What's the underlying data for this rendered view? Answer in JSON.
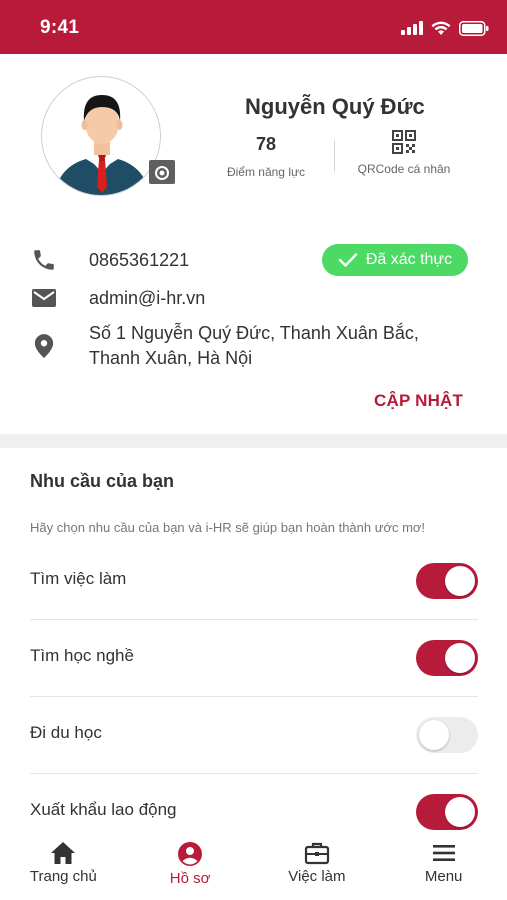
{
  "status_bar": {
    "time": "9:41"
  },
  "profile": {
    "name": "Nguyễn Quý Đức",
    "score_value": "78",
    "score_label": "Điểm năng lực",
    "qr_label": "QRCode cá nhân"
  },
  "contact": {
    "phone": "0865361221",
    "verified_label": "Đã xác thực",
    "email": "admin@i-hr.vn",
    "address_line1": "Số 1 Nguyễn Quý Đức, Thanh Xuân Bắc,",
    "address_line2": "Thanh Xuân, Hà Nội",
    "update_label": "CẬP NHẬT"
  },
  "needs": {
    "title": "Nhu cầu của bạn",
    "subtitle": "Hãy chọn nhu cầu của bạn và i-HR sẽ giúp bạn hoàn thành ước mơ!",
    "items": [
      {
        "label": "Tìm việc làm",
        "enabled": true
      },
      {
        "label": "Tìm học nghề",
        "enabled": true
      },
      {
        "label": "Đi du học",
        "enabled": false
      },
      {
        "label": "Xuất khẩu lao động",
        "enabled": true
      }
    ]
  },
  "tabs": [
    {
      "label": "Trang chủ",
      "icon": "home-icon",
      "active": false
    },
    {
      "label": "Hồ sơ",
      "icon": "user-icon",
      "active": true
    },
    {
      "label": "Việc làm",
      "icon": "briefcase-icon",
      "active": false
    },
    {
      "label": "Menu",
      "icon": "menu-icon",
      "active": false
    }
  ],
  "colors": {
    "brand": "#b81a3a",
    "verified": "#4cd964",
    "toggle_off": "#ececec"
  }
}
